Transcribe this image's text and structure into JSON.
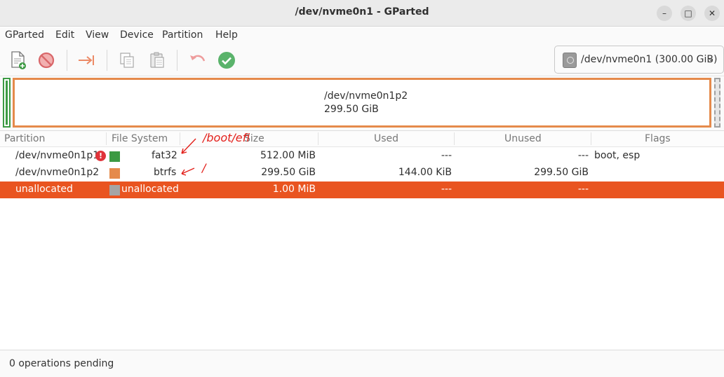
{
  "window": {
    "title": "/dev/nvme0n1 - GParted",
    "controls": {
      "minimize": "–",
      "maximize": "□",
      "close": "✕"
    }
  },
  "menu": [
    "GParted",
    "Edit",
    "View",
    "Device",
    "Partition",
    "Help"
  ],
  "toolbar": {
    "icons": [
      "new-partition-icon",
      "delete-icon",
      "resize-move-icon",
      "copy-icon",
      "paste-icon",
      "undo-icon",
      "apply-icon"
    ],
    "device_selector": "/dev/nvme0n1 (300.00 GiB)"
  },
  "disk_map": {
    "main_partition_name": "/dev/nvme0n1p2",
    "main_partition_size": "299.50 GiB"
  },
  "table": {
    "columns": [
      "Partition",
      "File System",
      "Size",
      "Used",
      "Unused",
      "Flags"
    ],
    "rows": [
      {
        "partition": "/dev/nvme0n1p1",
        "warning": "!",
        "fs": "fat32",
        "fs_color": "#3c9a43",
        "size": "512.00 MiB",
        "used": "---",
        "unused": "---",
        "flags": "boot, esp"
      },
      {
        "partition": "/dev/nvme0n1p2",
        "fs": "btrfs",
        "fs_color": "#e58a4b",
        "size": "299.50 GiB",
        "used": "144.00 KiB",
        "unused": "299.50 GiB",
        "flags": ""
      },
      {
        "partition": "unallocated",
        "fs": "unallocated",
        "fs_color": "#a5a5a5",
        "size": "1.00 MiB",
        "used": "---",
        "unused": "---",
        "flags": "",
        "selected": true
      }
    ]
  },
  "annotations": {
    "boot_efi": "/boot/efi",
    "root": "/"
  },
  "status": "0 operations pending",
  "colors": {
    "accent": "#e95420",
    "fat32": "#3c9a43",
    "btrfs": "#e58a4b",
    "unallocated": "#a5a5a5",
    "annotation": "#e3201b"
  }
}
